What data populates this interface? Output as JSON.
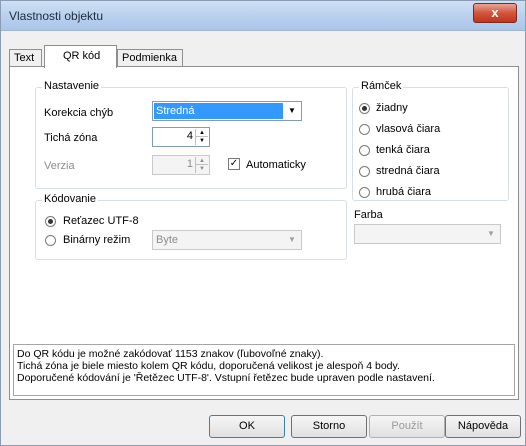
{
  "window": {
    "title": "Vlastnosti objektu",
    "close_label": "x"
  },
  "tabs": [
    {
      "label": "Text"
    },
    {
      "label": "QR kód"
    },
    {
      "label": "Podmienka"
    }
  ],
  "settings": {
    "title": "Nastavenie",
    "error_correction_label": "Korekcia chýb",
    "error_correction_value": "Stredná",
    "quiet_zone_label": "Tichá zóna",
    "quiet_zone_value": "4",
    "version_label": "Verzia",
    "version_value": "1",
    "auto_label": "Automaticky",
    "auto_checked": true
  },
  "encoding": {
    "title": "Kódovanie",
    "utf8_label": "Reťazec UTF-8",
    "binary_label": "Binárny režim",
    "binary_value": "Byte"
  },
  "frame": {
    "title": "Rámček",
    "options": [
      "žiadny",
      "vlasová čiara",
      "tenká čiara",
      "stredná čiara",
      "hrubá čiara"
    ],
    "selected": 0,
    "color_label": "Farba"
  },
  "info": {
    "lines": [
      "Do QR kódu je možné zakódovať 1153 znakov (ľubovoľné znaky).",
      "Tichá zóna je biele miesto kolem QR kódu, doporučená velikost je alespoň 4 body.",
      "Doporučené kódování je 'Řetězec UTF-8'. Vstupní řetězec bude upraven podle nastavení."
    ]
  },
  "buttons": {
    "ok": "OK",
    "cancel": "Storno",
    "apply": "Použít",
    "help": "Nápověda"
  }
}
